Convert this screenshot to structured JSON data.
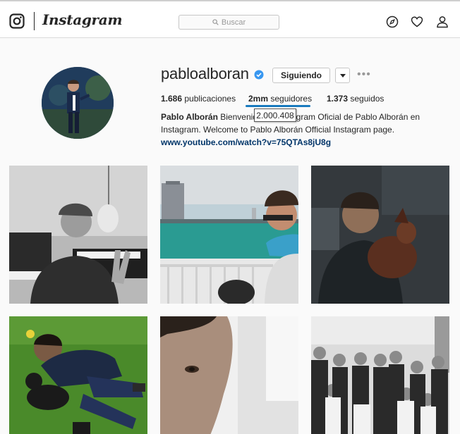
{
  "header": {
    "brand": "Instagram",
    "search_placeholder": "Buscar",
    "icons": [
      "instagram-logo-icon",
      "compass-icon",
      "heart-icon",
      "person-icon"
    ]
  },
  "profile": {
    "username": "pabloalboran",
    "verified": true,
    "follow_button": "Siguiendo",
    "more": "•••",
    "stats": {
      "posts_count": "1.686",
      "posts_label": "publicaciones",
      "followers_count": "2mm",
      "followers_label": "seguidores",
      "following_count": "1.373",
      "following_label": "seguidos"
    },
    "followers_tooltip": "2.000.408",
    "bio_name": "Pablo Alborán",
    "bio_text_1": "Bienvenidos al Instagram Oficial de Pablo Alborán en Instagram. Welcome to Pablo Alborán Official Instagram page.",
    "bio_link": "www.youtube.com/watch?v=75QTAs8jU8g"
  },
  "colors": {
    "accent_underline": "#1a7bbf",
    "verified": "#3897f0",
    "link": "#003569"
  },
  "posts": [
    {
      "name": "post-piano-selfie"
    },
    {
      "name": "post-harbor-selfie"
    },
    {
      "name": "post-dark-dog"
    },
    {
      "name": "post-grass-dog"
    },
    {
      "name": "post-closeup-face"
    },
    {
      "name": "post-group-photo"
    }
  ]
}
